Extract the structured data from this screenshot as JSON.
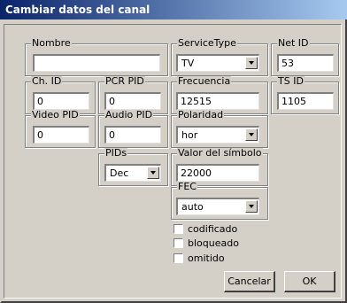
{
  "window": {
    "title": "Cambiar datos del canal"
  },
  "fields": {
    "nombre": {
      "label": "Nombre",
      "value": ""
    },
    "service_type": {
      "label": "ServiceType",
      "value": "TV"
    },
    "net_id": {
      "label": "Net ID",
      "value": "53"
    },
    "ch_id": {
      "label": "Ch. ID",
      "value": "0"
    },
    "pcr_pid": {
      "label": "PCR PID",
      "value": "0"
    },
    "frecuencia": {
      "label": "Frecuencia",
      "value": "12515"
    },
    "ts_id": {
      "label": "TS ID",
      "value": "1105"
    },
    "video_pid": {
      "label": "Video PID",
      "value": "0"
    },
    "audio_pid": {
      "label": "Audio PID",
      "value": "0"
    },
    "polaridad": {
      "label": "Polaridad",
      "value": "hor"
    },
    "pids": {
      "label": "PIDs",
      "value": "Dec"
    },
    "valor_simbolo": {
      "label": "Valor del símbolo",
      "value": "22000"
    },
    "fec": {
      "label": "FEC",
      "value": "auto"
    }
  },
  "checkboxes": {
    "codificado": {
      "label": "codificado",
      "checked": false
    },
    "bloqueado": {
      "label": "bloqueado",
      "checked": false
    },
    "omitido": {
      "label": "omitido",
      "checked": false
    }
  },
  "buttons": {
    "cancel": "Cancelar",
    "ok": "OK"
  }
}
